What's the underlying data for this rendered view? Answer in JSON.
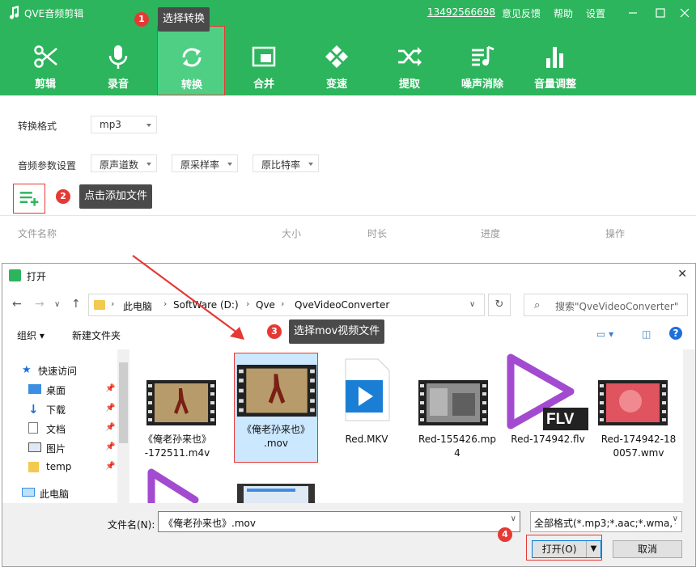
{
  "app": {
    "title": "QVE音频剪辑",
    "phone": "13492566698",
    "links": [
      "意见反馈",
      "帮助",
      "设置"
    ]
  },
  "toolbar": {
    "tools": [
      {
        "label": "剪辑",
        "icon": "scissors-icon"
      },
      {
        "label": "录音",
        "icon": "microphone-icon"
      },
      {
        "label": "转换",
        "icon": "convert-icon",
        "active": true
      },
      {
        "label": "合并",
        "icon": "merge-icon"
      },
      {
        "label": "变速",
        "icon": "speed-icon"
      },
      {
        "label": "提取",
        "icon": "extract-icon"
      },
      {
        "label": "噪声消除",
        "icon": "denoise-icon"
      },
      {
        "label": "音量调整",
        "icon": "volume-icon"
      }
    ]
  },
  "options": {
    "format_label": "转换格式",
    "format_value": "mp3",
    "params_label": "音频参数设置",
    "channel": "原声道数",
    "samplerate": "原采样率",
    "bitrate": "原比特率"
  },
  "columns": [
    "文件名称",
    "大小",
    "时长",
    "进度",
    "操作"
  ],
  "callouts": [
    {
      "num": "1",
      "text": "选择转换"
    },
    {
      "num": "2",
      "text": "点击添加文件"
    },
    {
      "num": "3",
      "text": "选择mov视频文件"
    },
    {
      "num": "4",
      "text": ""
    }
  ],
  "dialog": {
    "title": "打开",
    "breadcrumb": [
      "此电脑",
      "SoftWare (D:)",
      "Qve",
      "QveVideoConverter"
    ],
    "search_placeholder": "搜索\"QveVideoConverter\"",
    "organize": "组织",
    "new_folder": "新建文件夹",
    "nav": [
      {
        "label": "快速访问",
        "icon": "star-icon"
      },
      {
        "label": "桌面",
        "icon": "desktop-icon"
      },
      {
        "label": "下载",
        "icon": "download-icon"
      },
      {
        "label": "文档",
        "icon": "document-icon"
      },
      {
        "label": "图片",
        "icon": "pictures-icon"
      },
      {
        "label": "temp",
        "icon": "folder-icon"
      },
      {
        "label": "此电脑",
        "icon": "computer-icon"
      }
    ],
    "files": [
      {
        "name1": "《俺老孙来也》",
        "name2": "-172511.m4v",
        "kind": "film-brown"
      },
      {
        "name1": "《俺老孙来也》",
        "name2": ".mov",
        "kind": "film-brown",
        "selected": true
      },
      {
        "name1": "Red.MKV",
        "name2": "",
        "kind": "mkv"
      },
      {
        "name1": "Red-155426.mp",
        "name2": "4",
        "kind": "film-gray"
      },
      {
        "name1": "Red-174942.flv",
        "name2": "",
        "kind": "flv"
      },
      {
        "name1": "Red-174942-18",
        "name2": "0057.wmv",
        "kind": "film-red"
      }
    ],
    "filename_label": "文件名(N):",
    "filename_value": "《俺老孙来也》.mov",
    "filter_value": "全部格式(*.mp3;*.aac;*.wma;*",
    "open_button": "打开(O)",
    "cancel_button": "取消",
    "flv_badge": "FLV"
  },
  "colors": {
    "brand": "#2db55d",
    "callout": "#e53935",
    "selection": "#cce8ff"
  }
}
